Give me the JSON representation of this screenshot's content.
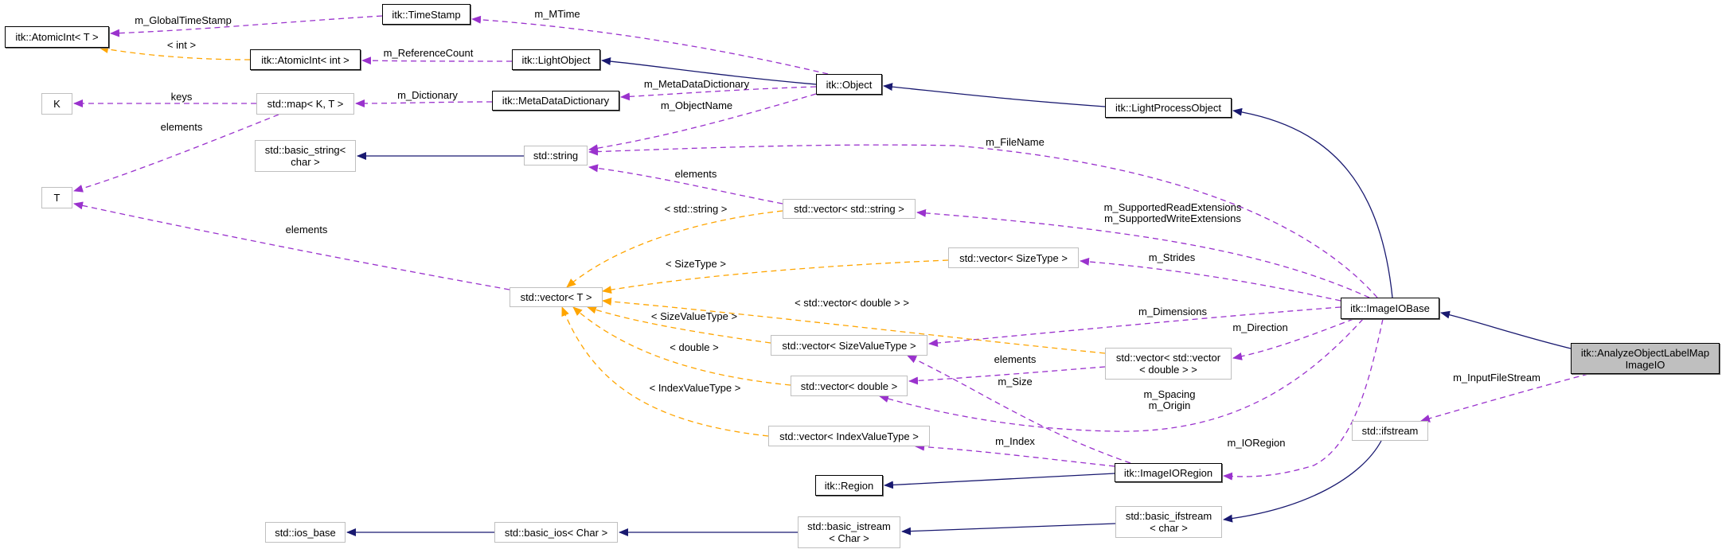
{
  "colors": {
    "inheritance": "#191970",
    "usage": "#9a32cd",
    "template": "#ffa500",
    "focus_fill": "#bfbfbf"
  },
  "nodes": {
    "atomicint_t": "itk::AtomicInt< T >",
    "k": "K",
    "t": "T",
    "atomicint_int": "itk::AtomicInt< int >",
    "std_map": "std::map< K, T >",
    "basic_string": "std::basic_string<\nchar >",
    "timestamp": "itk::TimeStamp",
    "lightobject": "itk::LightObject",
    "metadatadictionary": "itk::MetaDataDictionary",
    "std_string": "std::string",
    "object": "itk::Object",
    "lightprocessobject": "itk::LightProcessObject",
    "vector_string": "std::vector< std::string >",
    "vector_sizetype": "std::vector< SizeType >",
    "vector_t": "std::vector< T >",
    "vector_sizevaluetype": "std::vector< SizeValueType >",
    "vector_double": "std::vector< double >",
    "vector_indexvaluetype": "std::vector< IndexValueType >",
    "vector_vector_double": "std::vector< std::vector\n< double > >",
    "imageiobase": "itk::ImageIOBase",
    "analyze": "itk::AnalyzeObjectLabelMap\nImageIO",
    "ifstream": "std::ifstream",
    "imageioregion": "itk::ImageIORegion",
    "region": "itk::Region",
    "basic_ifstream": "std::basic_ifstream\n< char >",
    "basic_istream": "std::basic_istream\n< Char >",
    "basic_ios": "std::basic_ios< Char >",
    "ios_base": "std::ios_base"
  },
  "edge_labels": {
    "m_globaltimestamp": "m_GlobalTimeStamp",
    "int_tpl": "< int >",
    "m_mtime": "m_MTime",
    "m_referencecount": "m_ReferenceCount",
    "keys": "keys",
    "m_dictionary": "m_Dictionary",
    "map_elements": "elements",
    "m_metadatadictionary": "m_MetaDataDictionary",
    "m_objectname": "m_ObjectName",
    "m_filename": "m_FileName",
    "string_elements": "elements",
    "vector_elements": "elements",
    "std_string_tpl": "< std::string >",
    "m_supported_ext": "m_SupportedReadExtensions\nm_SupportedWriteExtensions",
    "sizetype_tpl": "< SizeType >",
    "m_strides": "m_Strides",
    "vector_double_tpl": "< std::vector< double > >",
    "m_dimensions": "m_Dimensions",
    "sizevaluetype_tpl": "< SizeValueType >",
    "m_direction": "m_Direction",
    "double_tpl": "< double >",
    "vv_elements": "elements",
    "m_size": "m_Size",
    "indexvaluetype_tpl": "< IndexValueType >",
    "m_spacing_origin": "m_Spacing\nm_Origin",
    "m_inputfilestream": "m_InputFileStream",
    "m_index": "m_Index",
    "m_ioregion": "m_IORegion"
  }
}
